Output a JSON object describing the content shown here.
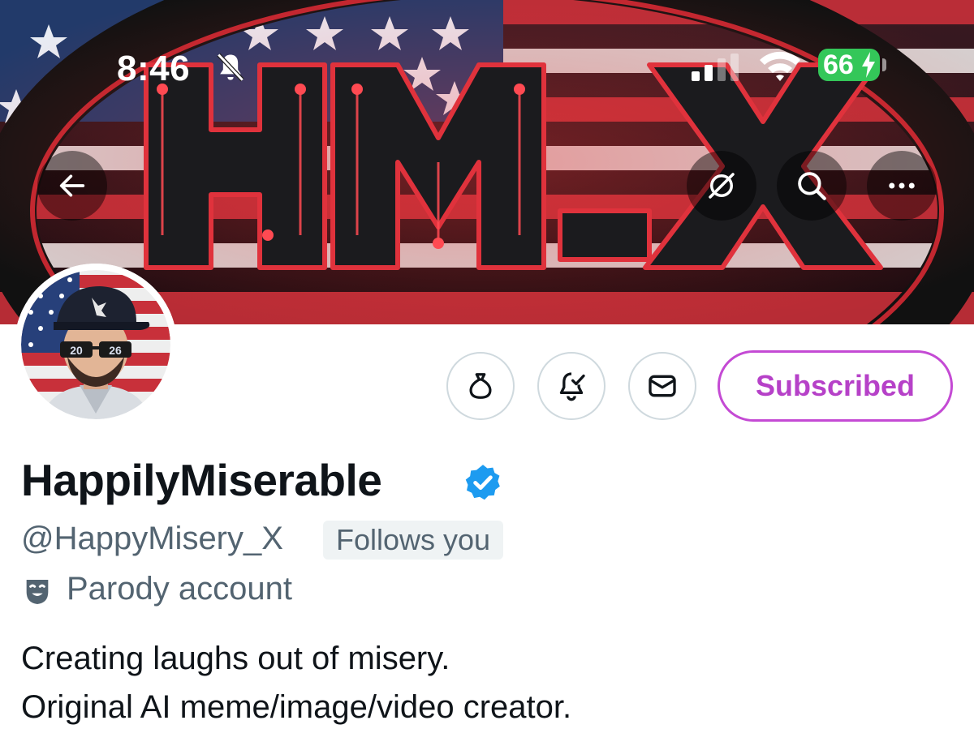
{
  "status_bar": {
    "time": "8:46",
    "battery_level": "66",
    "bell_icon": "bell-slash-icon",
    "signal_icon": "cellular-signal-icon",
    "wifi_icon": "wifi-icon"
  },
  "banner": {
    "logo_text": "HM X"
  },
  "nav": {
    "back_icon": "arrow-left-icon",
    "grok_icon": "grok-icon",
    "search_icon": "search-icon",
    "more_icon": "ellipsis-icon"
  },
  "actions": {
    "tip_icon": "money-bag-icon",
    "notify_icon": "bell-check-icon",
    "message_icon": "envelope-icon",
    "subscribed_label": "Subscribed"
  },
  "profile": {
    "display_name": "HappilyMiserable",
    "verified_icon": "verified-badge-icon",
    "handle": "@HappyMisery_X",
    "follows_you": "Follows you",
    "parody_icon": "theater-mask-icon",
    "parody_label": "Parody account",
    "bio": [
      "Creating laughs out of misery.",
      "Original AI meme/image/video creator."
    ]
  },
  "colors": {
    "subscribed_accent": "#b641c8",
    "verified_blue": "#1d9bf0",
    "battery_green": "#34c759",
    "text_primary": "#0f1419",
    "text_secondary": "#536471"
  }
}
